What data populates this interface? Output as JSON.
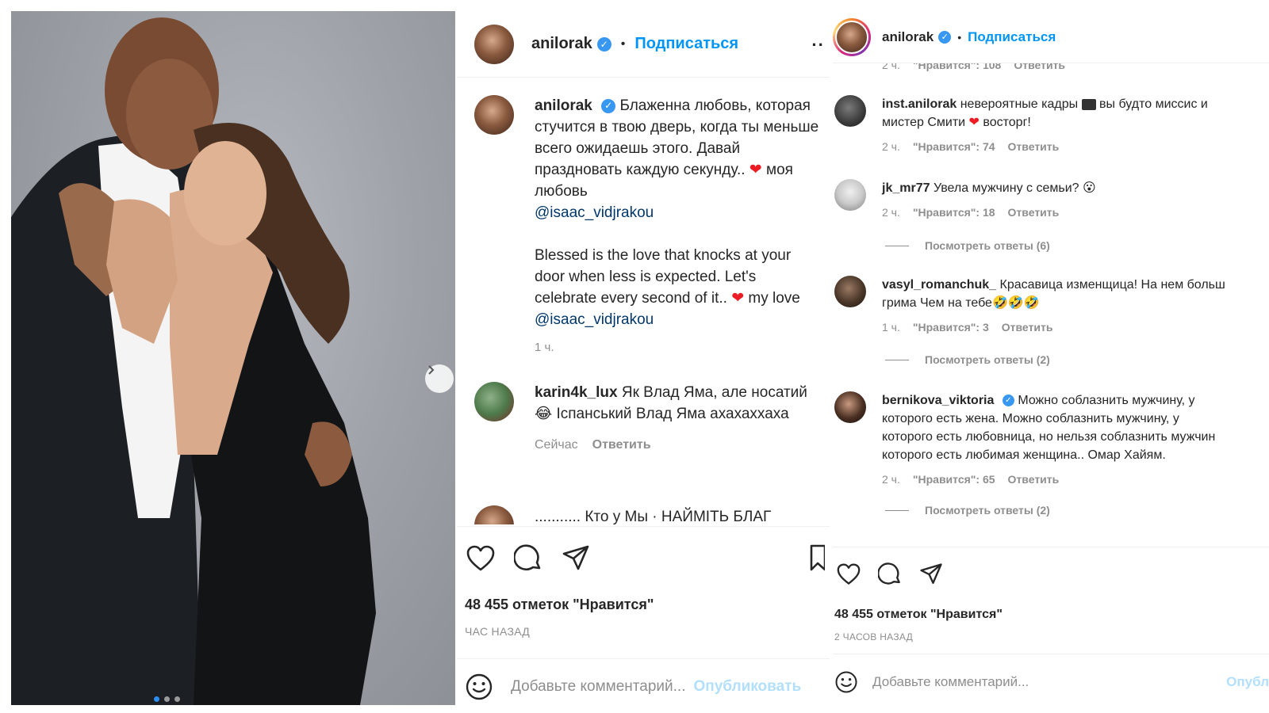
{
  "post": {
    "username": "anilorak",
    "verified_icon": "verified-badge-icon",
    "follow_label": "Подписаться",
    "more_label": "··",
    "caption_prefix": "anilorak",
    "caption_ru_1": "Блаженна любовь, которая стучится в твою дверь, когда ты меньше всего ожидаешь этого. Давай праздновать каждую секунду..",
    "caption_ru_2": "моя любовь",
    "caption_mention_1": "@isaac_vidjrakou",
    "caption_en_1": "Blessed is the love that knocks at your door when less is expected. Let's celebrate every second of it..",
    "caption_en_2": "my",
    "caption_en_3": "love",
    "caption_mention_2": "@isaac_vidjrakou",
    "caption_time": "1 ч.",
    "comment_1": {
      "username": "karin4k_lux",
      "text_1": "Як Влад Яма, але носатий",
      "emoji": "😂",
      "text_2": "Іспанський Влад Яма ахахаххаха",
      "time": "Сейчас",
      "reply_label": "Ответить"
    },
    "cut_line": "...........  Кто у  Мы  ·  НАЙМІТЬ БЛАГ",
    "likes": "48 455 отметок \"Нравится\"",
    "ago": "ЧАС НАЗАД",
    "comment_placeholder": "Добавьте комментарий...",
    "publish_label": "Опубликовать"
  },
  "right_post": {
    "username": "anilorak",
    "follow_label": "Подписаться",
    "cut_meta": [
      "2 ч.",
      "\"Нравится\": 108",
      "Ответить"
    ],
    "comments": [
      {
        "username": "inst.anilorak",
        "text_1": "невероятные кадры",
        "text_2": "вы будто миссис и",
        "text_3": "мистер Смити",
        "text_4": "восторг!",
        "time": "2 ч.",
        "likes": "\"Нравится\": 74",
        "reply": "Ответить"
      },
      {
        "username": "jk_mr77",
        "text_1": "Увела мужчину с семьи?",
        "emoji": "😮",
        "time": "2 ч.",
        "likes": "\"Нравится\": 18",
        "reply": "Ответить",
        "view_replies": "Посмотреть ответы (6)"
      },
      {
        "username": "vasyl_romanchuk_",
        "text_1": "Красавица изменщица! На нем больш",
        "text_2": "грима Чем на тебе",
        "emoji": "🤣🤣🤣",
        "time": "1 ч.",
        "likes": "\"Нравится\": 3",
        "reply": "Ответить",
        "view_replies": "Посмотреть ответы (2)"
      },
      {
        "username": "bernikova_viktoria",
        "text_1": "Можно соблазнить мужчину, у",
        "text_2": "которого есть жена. Можно соблазнить мужчину, у",
        "text_3": "которого есть любовница, но нельзя соблазнить мужчин",
        "text_4": "которого есть любимая женщина.. Омар Хайям.",
        "time": "2 ч.",
        "likes": "\"Нравится\": 65",
        "reply": "Ответить",
        "view_replies": "Посмотреть ответы (2)"
      }
    ],
    "likes": "48 455 отметок \"Нравится\"",
    "ago": "2 ЧАСОВ НАЗАД",
    "comment_placeholder": "Добавьте комментарий...",
    "publish_label": "Опубл"
  },
  "colors": {
    "accent": "#0095f6",
    "verified": "#3897f0",
    "heart": "#ed1c24",
    "muted": "#8e8e8e",
    "text": "#262626"
  }
}
